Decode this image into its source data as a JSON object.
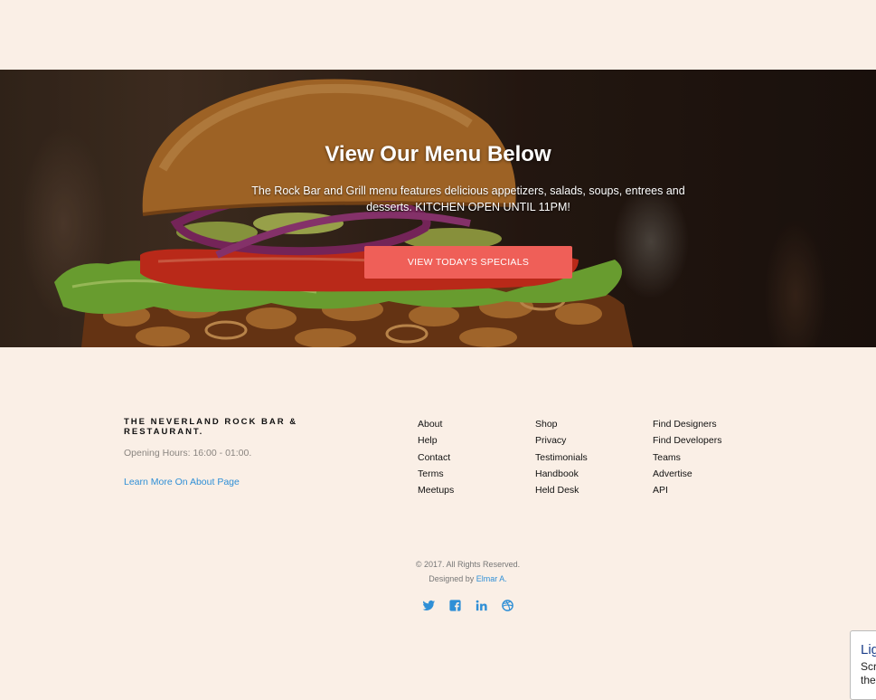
{
  "hero": {
    "title": "View Our Menu Below",
    "text": "The Rock Bar and Grill menu features delicious appetizers, salads, soups, entrees and desserts. KITCHEN OPEN UNTIL 11PM!",
    "button_label": "VIEW TODAY'S SPECIALS"
  },
  "footer": {
    "brand": "THE NEVERLAND ROCK BAR & RESTAURANT.",
    "hours": "Opening Hours: 16:00 - 01:00.",
    "learn_more": "Learn More On About Page",
    "columns": [
      [
        "About",
        "Help",
        "Contact",
        "Terms",
        "Meetups"
      ],
      [
        "Shop",
        "Privacy",
        "Testimonials",
        "Handbook",
        "Held Desk"
      ],
      [
        "Find Designers",
        "Find Developers",
        "Teams",
        "Advertise",
        "API"
      ]
    ],
    "copyright": "© 2017. All Rights Reserved.",
    "designed_by": "Designed by",
    "designer": "Elmar A.",
    "social": [
      "twitter-icon",
      "facebook-icon",
      "linkedin-icon",
      "dribbble-icon"
    ]
  },
  "widget": {
    "title": "Lig",
    "line1": "Scr",
    "line2": "the"
  },
  "colors": {
    "background": "#faefe6",
    "accent": "#ef5f58",
    "link": "#2f8fd6"
  }
}
